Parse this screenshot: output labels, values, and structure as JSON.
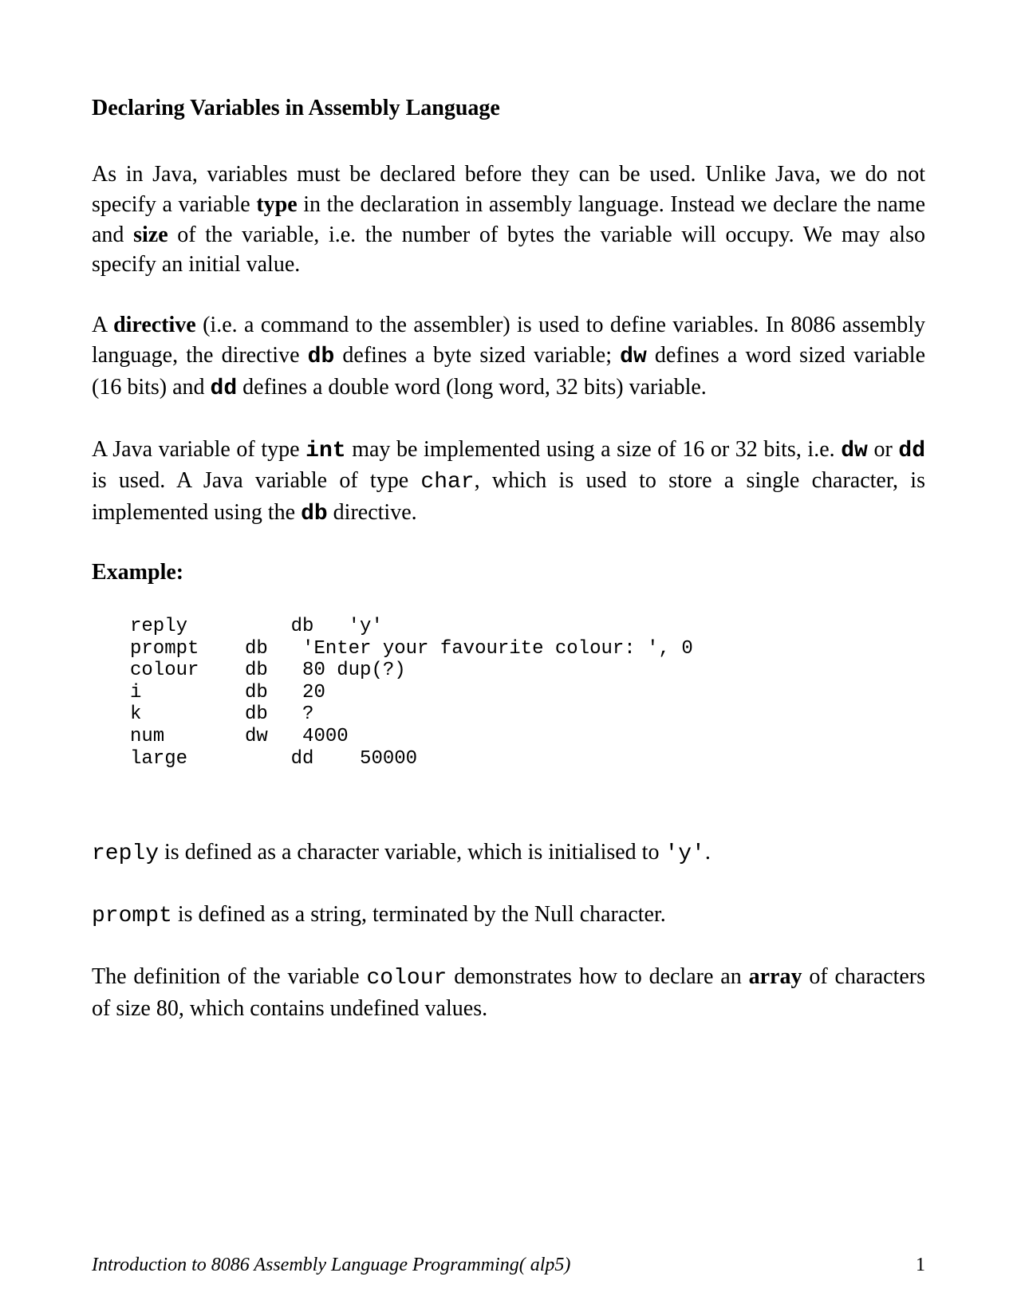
{
  "title": "Declaring Variables in Assembly Language",
  "p1_a": "As in Java, variables must be declared before they can be used. Unlike Java, we do not specify a variable ",
  "p1_b": "type",
  "p1_c": " in the declaration in assembly language. Instead we declare the name and ",
  "p1_d": "size",
  "p1_e": " of the variable, i.e. the number of bytes the variable will occupy. We may also specify an initial value.",
  "p2_a": "A ",
  "p2_b": "directive",
  "p2_c": " (i.e. a command to the assembler) is used to define variables. In 8086 assembly language, the directive ",
  "p2_d": "db",
  "p2_e": " defines a byte sized variable; ",
  "p2_f": "dw",
  "p2_g": " defines a word sized variable (16 bits) and ",
  "p2_h": "dd",
  "p2_i": " defines a double word (long word, 32 bits) variable.",
  "p3_a": "A Java variable of type ",
  "p3_b": "int",
  "p3_c": " may be implemented using a size of 16 or 32 bits, i.e. ",
  "p3_d": "dw",
  "p3_e": " or ",
  "p3_f": "dd",
  "p3_g": " is used. A Java variable of type ",
  "p3_h": "char",
  "p3_i": ", which is used to store a single character, is implemented using the ",
  "p3_j": "db",
  "p3_k": " directive.",
  "example_label": "Example:",
  "code": "reply         db   'y'\nprompt    db   'Enter your favourite colour: ', 0\ncolour    db   80 dup(?)\ni         db   20\nk         db   ?\nnum       dw   4000\nlarge         dd    50000",
  "p4_a": "reply",
  "p4_b": " is defined as a character variable, which is initialised to ",
  "p4_c": "'y'",
  "p4_d": ".",
  "p5_a": "prompt",
  "p5_b": " is defined as a string, terminated by the Null character.",
  "p6_a": "The definition of the variable ",
  "p6_b": "colour",
  "p6_c": " demonstrates how to declare an ",
  "p6_d": "array",
  "p6_e": " of characters of size 80, which contains undefined values.",
  "footer_left": "Introduction to 8086 Assembly Language Programming( alp5)",
  "footer_right": "1"
}
